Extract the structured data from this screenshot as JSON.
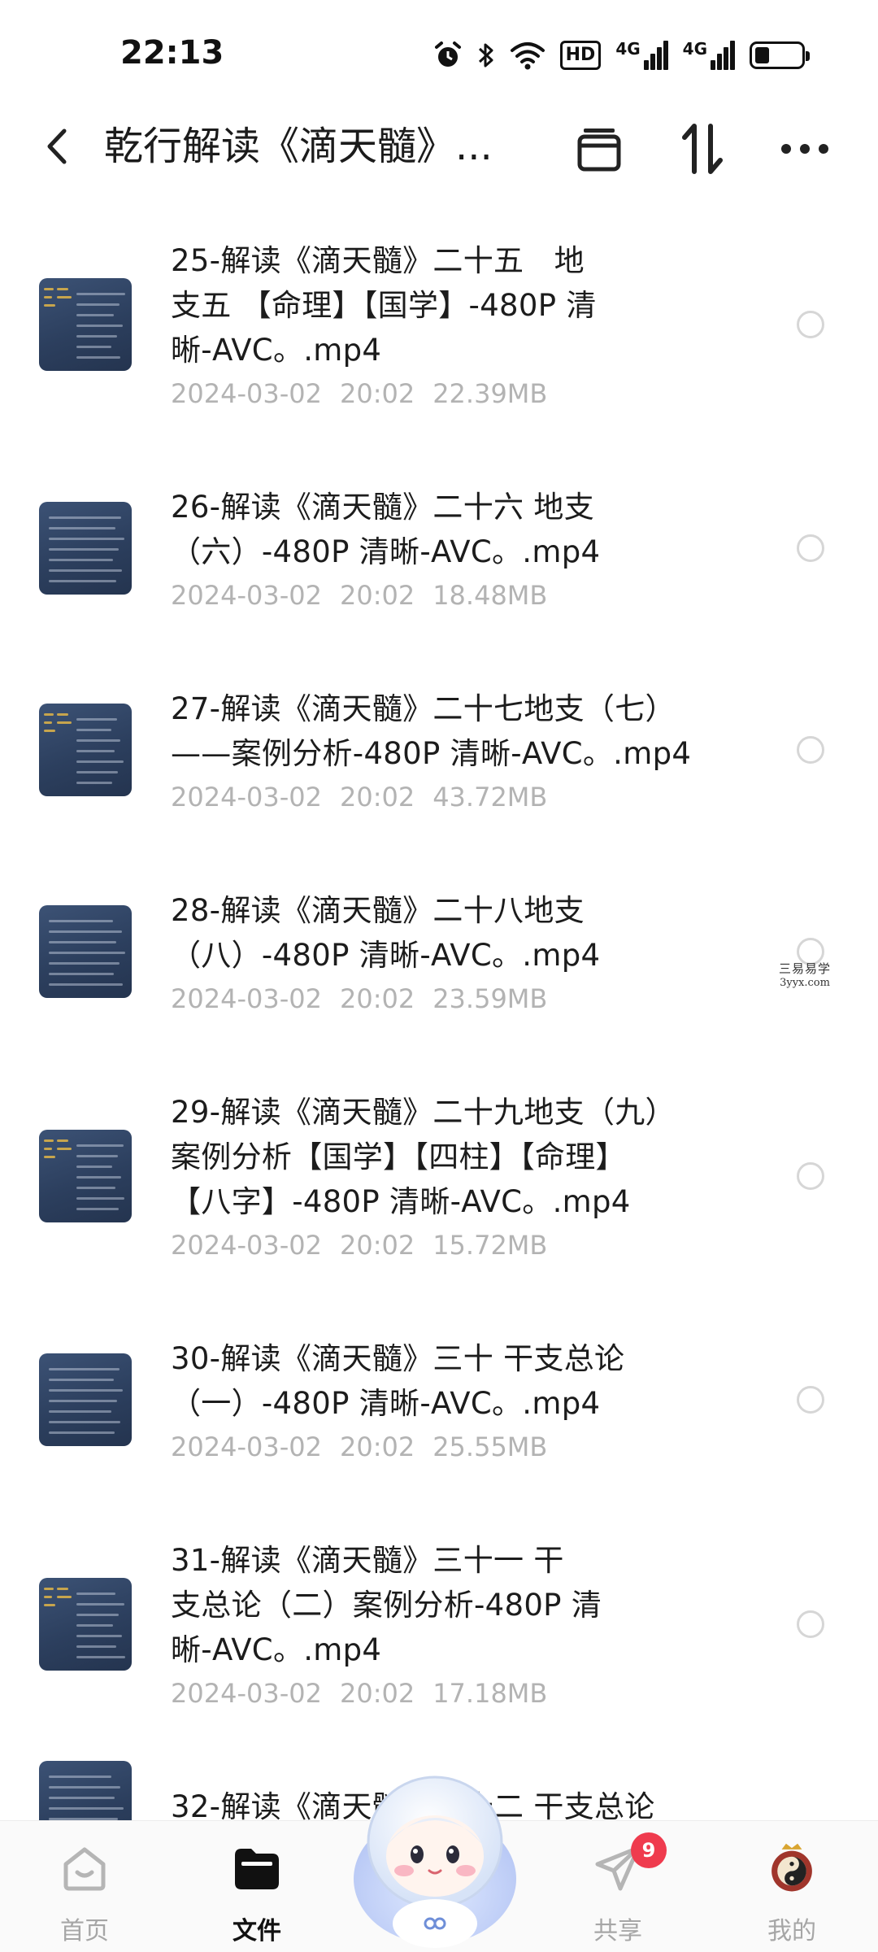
{
  "status_bar": {
    "time": "22:13",
    "icons": [
      "alarm-icon",
      "bluetooth-icon",
      "wifi-icon",
      "hd-icon",
      "signal-4g-icon",
      "signal-4g-icon",
      "battery-icon"
    ],
    "hd_label": "HD",
    "network_labels": [
      "4G",
      "4G"
    ],
    "battery_level": 0.32
  },
  "header": {
    "title": "乾行解读《滴天髓》...",
    "actions": [
      "archive-icon",
      "sort-icon",
      "more-icon"
    ]
  },
  "files": [
    {
      "name_lines": [
        "25-解读《滴天髓》二十五　地",
        "支五 【命理】【国学】-480P 清",
        "晰-AVC。.mp4"
      ],
      "date": "2024-03-02",
      "time": "20:02",
      "size": "22.39MB"
    },
    {
      "name_lines": [
        "26-解读《滴天髓》二十六  地支",
        "（六）-480P 清晰-AVC。.mp4"
      ],
      "date": "2024-03-02",
      "time": "20:02",
      "size": "18.48MB"
    },
    {
      "name_lines": [
        "27-解读《滴天髓》二十七地支（七）",
        "——案例分析-480P 清晰-AVC。.mp4"
      ],
      "date": "2024-03-02",
      "time": "20:02",
      "size": "43.72MB"
    },
    {
      "name_lines": [
        "28-解读《滴天髓》二十八地支",
        "（八）-480P 清晰-AVC。.mp4"
      ],
      "date": "2024-03-02",
      "time": "20:02",
      "size": "23.59MB"
    },
    {
      "name_lines": [
        "29-解读《滴天髓》二十九地支（九）",
        "案例分析【国学】【四柱】【命理】",
        "【八字】-480P 清晰-AVC。.mp4"
      ],
      "date": "2024-03-02",
      "time": "20:02",
      "size": "15.72MB"
    },
    {
      "name_lines": [
        "30-解读《滴天髓》三十  干支总论",
        "（一）-480P 清晰-AVC。.mp4"
      ],
      "date": "2024-03-02",
      "time": "20:02",
      "size": "25.55MB"
    },
    {
      "name_lines": [
        "31-解读《滴天髓》三十一   干",
        "支总论（二）案例分析-480P 清",
        "晰-AVC。.mp4"
      ],
      "date": "2024-03-02",
      "time": "20:02",
      "size": "17.18MB"
    },
    {
      "name_lines": [
        "32-解读《滴天髓》三十二 干支总论"
      ],
      "date": "",
      "time": "",
      "size": ""
    }
  ],
  "watermark": {
    "line1": "三易易学",
    "line2": "3yyx.com"
  },
  "bottom_nav": {
    "items": [
      {
        "label": "首页",
        "icon": "home-icon",
        "active": false
      },
      {
        "label": "文件",
        "icon": "folder-icon",
        "active": true
      },
      {
        "label": "共享",
        "icon": "send-icon",
        "active": false,
        "badge": "9"
      },
      {
        "label": "我的",
        "icon": "avatar-icon",
        "active": false
      }
    ],
    "center_icon": "mascot-icon"
  },
  "colors": {
    "text_primary": "#1c1c1c",
    "text_meta": "#b3b3b3",
    "thumb_bg": "#2c3f5e",
    "badge": "#ef3b4e",
    "nav_inactive": "#a6a6a6"
  }
}
